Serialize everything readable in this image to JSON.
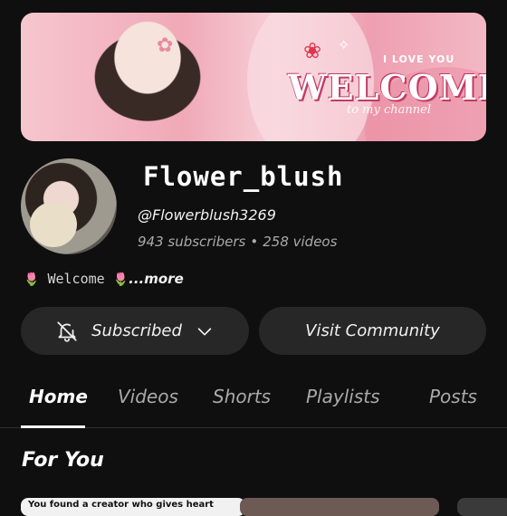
{
  "banner": {
    "welcome_text": "WELCOME",
    "subtitle": "I LOVE YOU",
    "tagline": "to my channel"
  },
  "channel": {
    "name": "Flower_blush",
    "handle": "@Flowerblush3269",
    "subscribers": "943 subscribers",
    "videos": "258 videos",
    "separator": "•",
    "description": "Welcome",
    "more_label": "...more"
  },
  "actions": {
    "subscribed_label": "Subscribed",
    "community_label": "Visit Community"
  },
  "tabs": [
    {
      "label": "Home",
      "active": true
    },
    {
      "label": "Videos",
      "active": false
    },
    {
      "label": "Shorts",
      "active": false
    },
    {
      "label": "Playlists",
      "active": false
    },
    {
      "label": "Posts",
      "active": false
    }
  ],
  "section": {
    "title": "For You"
  },
  "cards": [
    {
      "caption": "You found a creator who gives heart"
    }
  ],
  "colors": {
    "background": "#0f0f0f",
    "button_bg": "#272727",
    "muted_text": "#aaaaaa",
    "banner_pink": "#f0a9b7"
  }
}
